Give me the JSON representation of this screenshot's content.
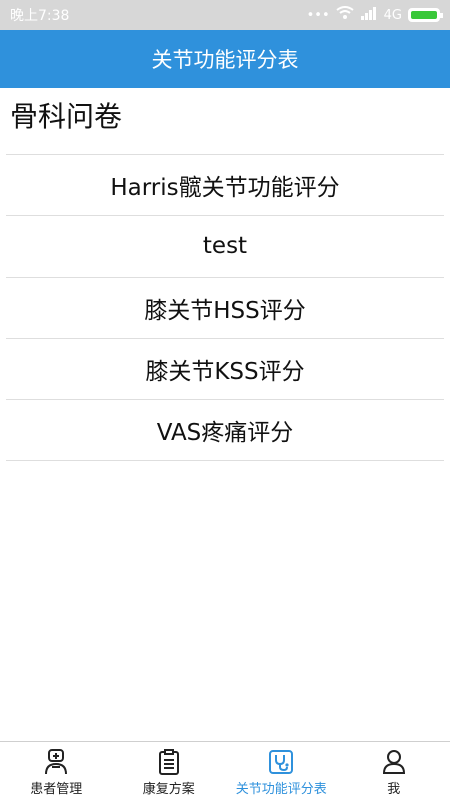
{
  "status_bar": {
    "time": "晚上7:38",
    "signal_text": "... ",
    "network": "4G"
  },
  "header": {
    "title": "关节功能评分表"
  },
  "section": {
    "title": "骨科问卷"
  },
  "list": {
    "items": [
      {
        "label": "Harris髋关节功能评分"
      },
      {
        "label": "test"
      },
      {
        "label": "膝关节HSS评分"
      },
      {
        "label": "膝关节KSS评分"
      },
      {
        "label": "VAS疼痛评分"
      }
    ]
  },
  "tabs": [
    {
      "label": "患者管理",
      "icon": "patient-icon"
    },
    {
      "label": "康复方案",
      "icon": "clipboard-icon"
    },
    {
      "label": "关节功能评分表",
      "icon": "stethoscope-icon",
      "active": true
    },
    {
      "label": "我",
      "icon": "person-icon"
    }
  ],
  "colors": {
    "accent": "#2f91dc",
    "status_bar": "#d7d7d7",
    "battery": "#39c839"
  }
}
